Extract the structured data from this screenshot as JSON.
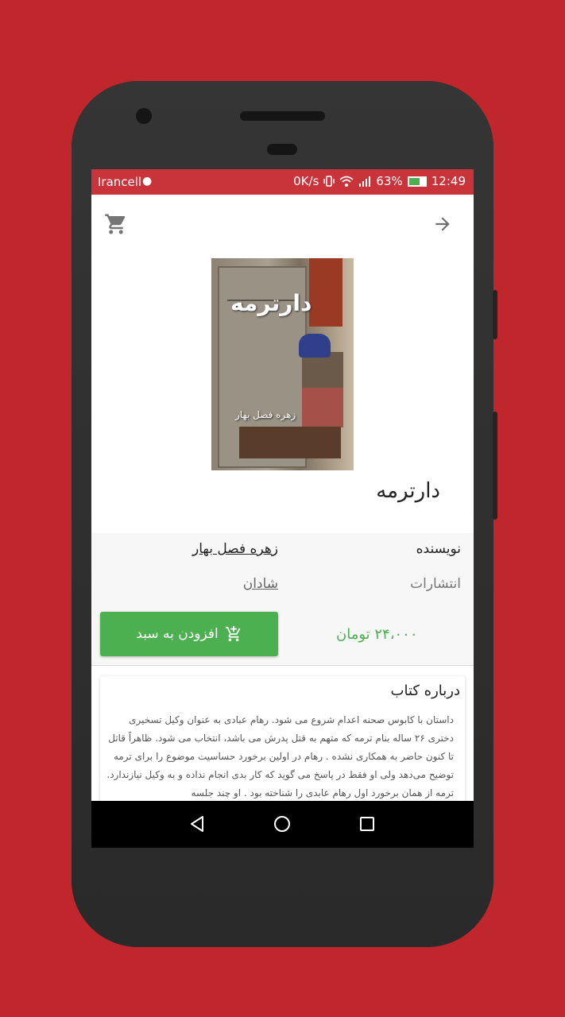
{
  "status_bar": {
    "carrier": "Irancell",
    "speed": "0K/s",
    "signal_percent": "63%",
    "time": "12:49"
  },
  "book": {
    "title": "دارترمه",
    "cover_title": "دارترمه",
    "cover_author": "زهره فصل بهار"
  },
  "info": {
    "author_label": "نویسنده",
    "author_value": "زهره فصل بهار",
    "publisher_label": "انتشارات",
    "publisher_value": "شادان",
    "price": "۲۴،۰۰۰ تومان",
    "add_to_cart_label": "افزودن به سبد"
  },
  "about": {
    "title": "درباره کتاب",
    "text": "داستان با کابوس صحنه اعدام شروع می شود. رهام عبادی به عنوان وکیل تسخیری دختری ۲۶ ساله بنام ترمه که متهم به قتل پدرش می باشد، انتخاب می شود. ظاهراً قاتل تا کنون حاضر به همکاری نشده . رهام در اولین برخورد حساسیت موضوع را برای ترمه توضیح می‌دهد ولی او فقط در پاسخ می گوید که کار بدی انجام نداده و به وکیل نیازندارد. ترمه از همان برخورد اول رهام عابدی را شناخته بود . او چند جلسه"
  },
  "colors": {
    "background": "#c0272d",
    "status_bar": "#c9343a",
    "accent_green": "#4caf50"
  },
  "icons": {
    "back": "arrow-right-icon",
    "cart": "cart-icon",
    "add_cart": "add-cart-icon",
    "nav_back": "triangle-back-icon",
    "nav_home": "circle-home-icon",
    "nav_recents": "square-recents-icon"
  }
}
